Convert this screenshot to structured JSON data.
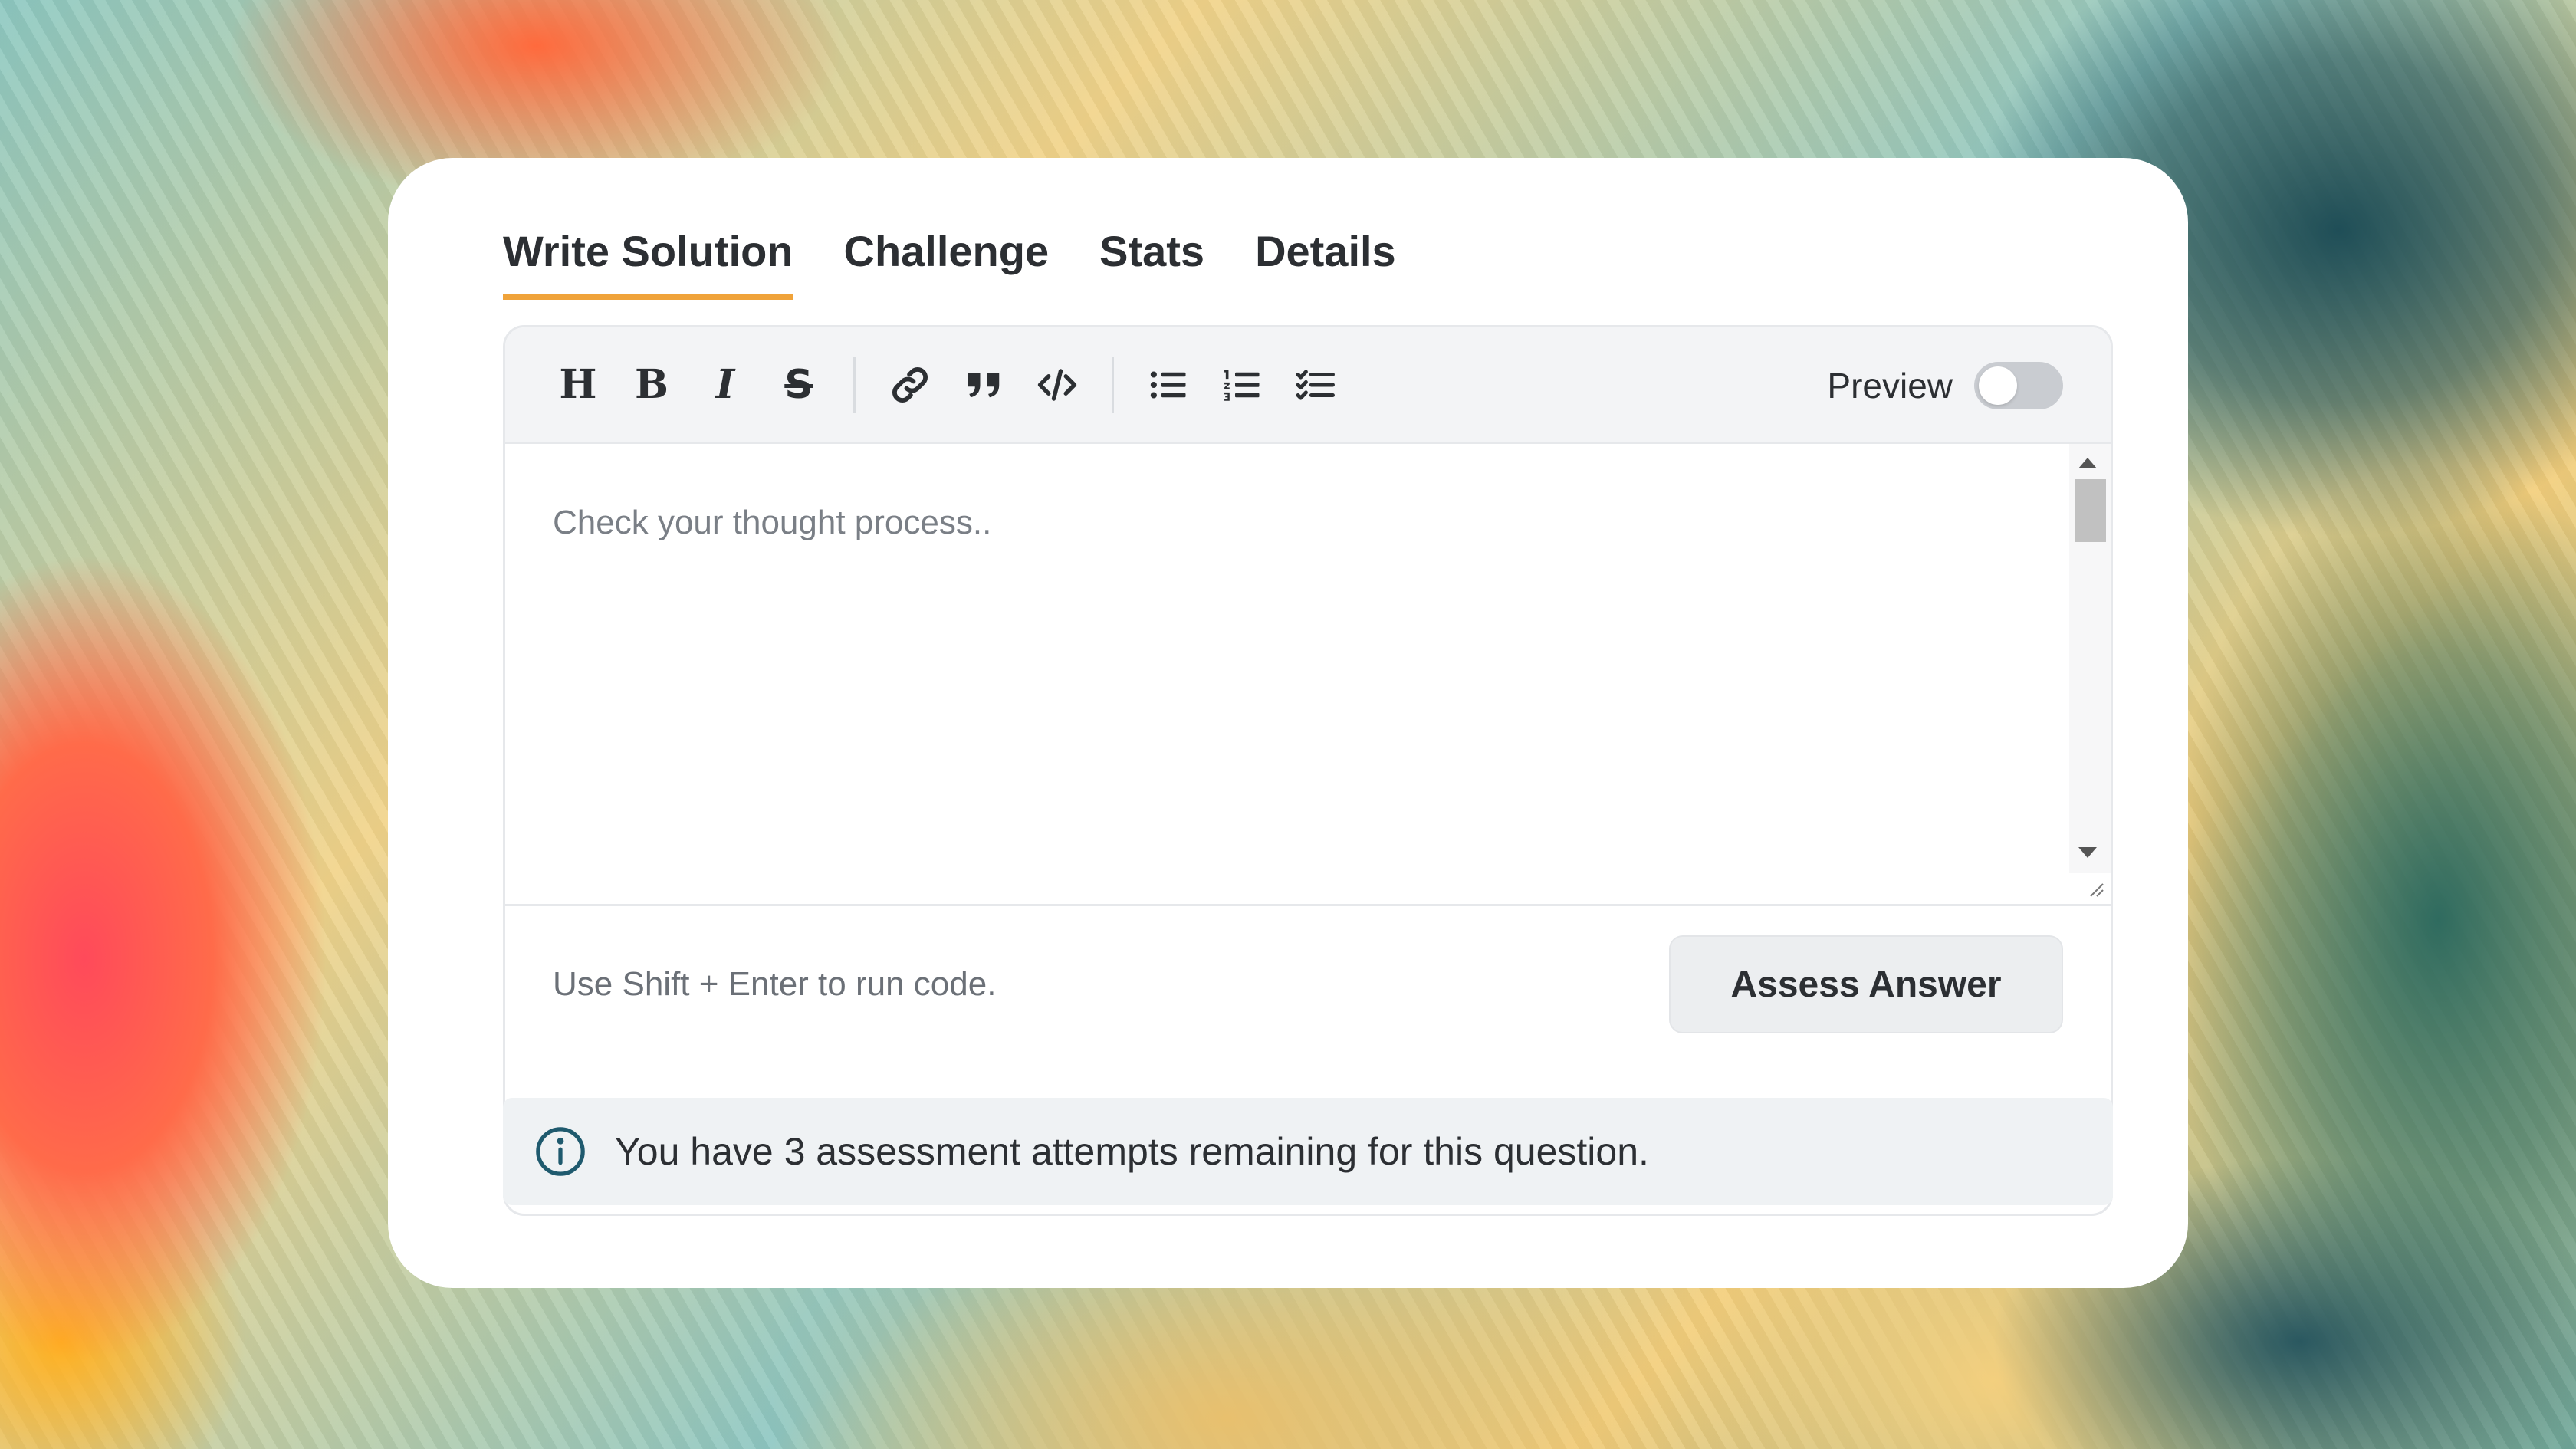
{
  "tabs": [
    {
      "label": "Write Solution",
      "active": true
    },
    {
      "label": "Challenge",
      "active": false
    },
    {
      "label": "Stats",
      "active": false
    },
    {
      "label": "Details",
      "active": false
    }
  ],
  "toolbar": {
    "heading_glyph": "H",
    "bold_glyph": "B",
    "italic_glyph": "I",
    "strike_glyph": "S",
    "icons": [
      "heading-icon",
      "bold-icon",
      "italic-icon",
      "strikethrough-icon",
      "link-icon",
      "quote-icon",
      "code-icon",
      "bulleted-list-icon",
      "numbered-list-icon",
      "task-list-icon"
    ],
    "preview_label": "Preview",
    "preview_enabled": false
  },
  "editor": {
    "placeholder": "Check your thought process..",
    "value": ""
  },
  "footer": {
    "hint": "Use Shift + Enter to run code.",
    "assess_label": "Assess Answer"
  },
  "notice": {
    "icon": "info-icon",
    "text": "You have 3 assessment attempts remaining for this question."
  },
  "colors": {
    "accent": "#f0a33a",
    "text": "#2c2f33",
    "info_icon": "#1f5a6e"
  }
}
